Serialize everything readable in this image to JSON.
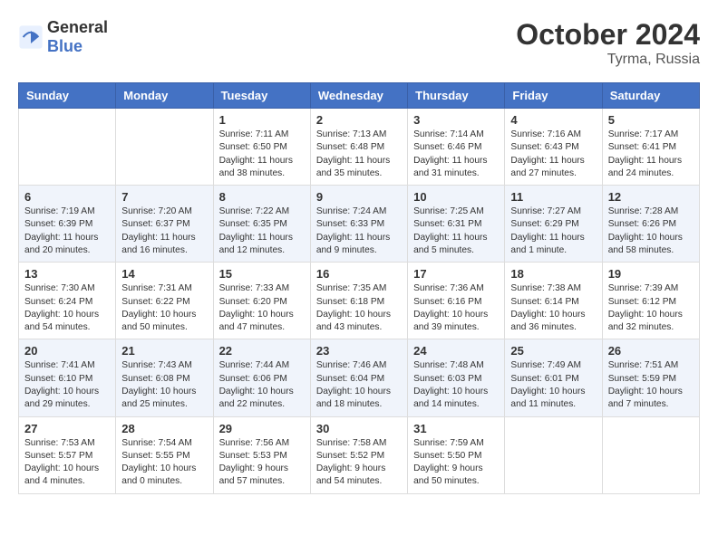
{
  "logo": {
    "general": "General",
    "blue": "Blue"
  },
  "title": "October 2024",
  "location": "Tyrma, Russia",
  "days_of_week": [
    "Sunday",
    "Monday",
    "Tuesday",
    "Wednesday",
    "Thursday",
    "Friday",
    "Saturday"
  ],
  "weeks": [
    [
      {
        "day": "",
        "content": ""
      },
      {
        "day": "",
        "content": ""
      },
      {
        "day": "1",
        "content": "Sunrise: 7:11 AM\nSunset: 6:50 PM\nDaylight: 11 hours and 38 minutes."
      },
      {
        "day": "2",
        "content": "Sunrise: 7:13 AM\nSunset: 6:48 PM\nDaylight: 11 hours and 35 minutes."
      },
      {
        "day": "3",
        "content": "Sunrise: 7:14 AM\nSunset: 6:46 PM\nDaylight: 11 hours and 31 minutes."
      },
      {
        "day": "4",
        "content": "Sunrise: 7:16 AM\nSunset: 6:43 PM\nDaylight: 11 hours and 27 minutes."
      },
      {
        "day": "5",
        "content": "Sunrise: 7:17 AM\nSunset: 6:41 PM\nDaylight: 11 hours and 24 minutes."
      }
    ],
    [
      {
        "day": "6",
        "content": "Sunrise: 7:19 AM\nSunset: 6:39 PM\nDaylight: 11 hours and 20 minutes."
      },
      {
        "day": "7",
        "content": "Sunrise: 7:20 AM\nSunset: 6:37 PM\nDaylight: 11 hours and 16 minutes."
      },
      {
        "day": "8",
        "content": "Sunrise: 7:22 AM\nSunset: 6:35 PM\nDaylight: 11 hours and 12 minutes."
      },
      {
        "day": "9",
        "content": "Sunrise: 7:24 AM\nSunset: 6:33 PM\nDaylight: 11 hours and 9 minutes."
      },
      {
        "day": "10",
        "content": "Sunrise: 7:25 AM\nSunset: 6:31 PM\nDaylight: 11 hours and 5 minutes."
      },
      {
        "day": "11",
        "content": "Sunrise: 7:27 AM\nSunset: 6:29 PM\nDaylight: 11 hours and 1 minute."
      },
      {
        "day": "12",
        "content": "Sunrise: 7:28 AM\nSunset: 6:26 PM\nDaylight: 10 hours and 58 minutes."
      }
    ],
    [
      {
        "day": "13",
        "content": "Sunrise: 7:30 AM\nSunset: 6:24 PM\nDaylight: 10 hours and 54 minutes."
      },
      {
        "day": "14",
        "content": "Sunrise: 7:31 AM\nSunset: 6:22 PM\nDaylight: 10 hours and 50 minutes."
      },
      {
        "day": "15",
        "content": "Sunrise: 7:33 AM\nSunset: 6:20 PM\nDaylight: 10 hours and 47 minutes."
      },
      {
        "day": "16",
        "content": "Sunrise: 7:35 AM\nSunset: 6:18 PM\nDaylight: 10 hours and 43 minutes."
      },
      {
        "day": "17",
        "content": "Sunrise: 7:36 AM\nSunset: 6:16 PM\nDaylight: 10 hours and 39 minutes."
      },
      {
        "day": "18",
        "content": "Sunrise: 7:38 AM\nSunset: 6:14 PM\nDaylight: 10 hours and 36 minutes."
      },
      {
        "day": "19",
        "content": "Sunrise: 7:39 AM\nSunset: 6:12 PM\nDaylight: 10 hours and 32 minutes."
      }
    ],
    [
      {
        "day": "20",
        "content": "Sunrise: 7:41 AM\nSunset: 6:10 PM\nDaylight: 10 hours and 29 minutes."
      },
      {
        "day": "21",
        "content": "Sunrise: 7:43 AM\nSunset: 6:08 PM\nDaylight: 10 hours and 25 minutes."
      },
      {
        "day": "22",
        "content": "Sunrise: 7:44 AM\nSunset: 6:06 PM\nDaylight: 10 hours and 22 minutes."
      },
      {
        "day": "23",
        "content": "Sunrise: 7:46 AM\nSunset: 6:04 PM\nDaylight: 10 hours and 18 minutes."
      },
      {
        "day": "24",
        "content": "Sunrise: 7:48 AM\nSunset: 6:03 PM\nDaylight: 10 hours and 14 minutes."
      },
      {
        "day": "25",
        "content": "Sunrise: 7:49 AM\nSunset: 6:01 PM\nDaylight: 10 hours and 11 minutes."
      },
      {
        "day": "26",
        "content": "Sunrise: 7:51 AM\nSunset: 5:59 PM\nDaylight: 10 hours and 7 minutes."
      }
    ],
    [
      {
        "day": "27",
        "content": "Sunrise: 7:53 AM\nSunset: 5:57 PM\nDaylight: 10 hours and 4 minutes."
      },
      {
        "day": "28",
        "content": "Sunrise: 7:54 AM\nSunset: 5:55 PM\nDaylight: 10 hours and 0 minutes."
      },
      {
        "day": "29",
        "content": "Sunrise: 7:56 AM\nSunset: 5:53 PM\nDaylight: 9 hours and 57 minutes."
      },
      {
        "day": "30",
        "content": "Sunrise: 7:58 AM\nSunset: 5:52 PM\nDaylight: 9 hours and 54 minutes."
      },
      {
        "day": "31",
        "content": "Sunrise: 7:59 AM\nSunset: 5:50 PM\nDaylight: 9 hours and 50 minutes."
      },
      {
        "day": "",
        "content": ""
      },
      {
        "day": "",
        "content": ""
      }
    ]
  ]
}
